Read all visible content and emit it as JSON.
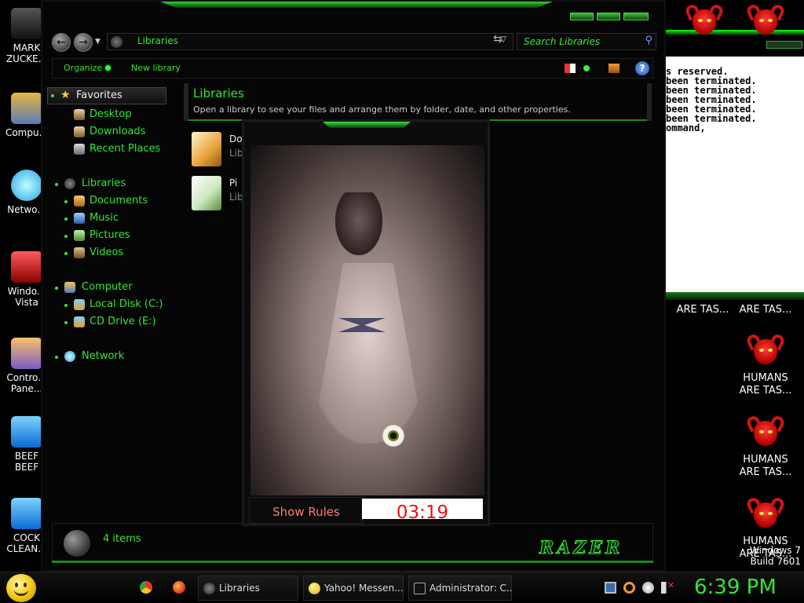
{
  "desktop": {
    "icons": [
      {
        "label": "MARK ZUCKE..."
      },
      {
        "label": "Compu..."
      },
      {
        "label": "Netwo..."
      },
      {
        "label": "Windo... Vista"
      },
      {
        "label": "Contro... Pane..."
      },
      {
        "label": "BEEF BEEF"
      },
      {
        "label": "COCK CLEAN..."
      }
    ],
    "demon_labels": [
      "ARE TAS...",
      "ARE TAS...",
      "HUMANS ARE TAS...",
      "HUMANS ARE TAS...",
      "HUMANS ARE TAS..."
    ],
    "watermark_line1": "Windows 7",
    "watermark_line2": "Build 7601"
  },
  "console": {
    "lines": [
      "s reserved.",
      "",
      "",
      "been terminated.",
      "been terminated.",
      "been terminated.",
      "been terminated.",
      "been terminated.",
      "",
      "",
      "",
      "",
      "",
      "",
      "",
      "",
      "",
      "",
      "ommand,"
    ]
  },
  "explorer": {
    "address": "Libraries",
    "search_placeholder": "Search Libraries",
    "toolbar": {
      "organize": "Organize",
      "new_library": "New library"
    },
    "nav": {
      "favorites": "Favorites",
      "desktop": "Desktop",
      "downloads": "Downloads",
      "recent": "Recent Places",
      "libraries": "Libraries",
      "documents": "Documents",
      "music": "Music",
      "pictures": "Pictures",
      "videos": "Videos",
      "computer": "Computer",
      "local_disk": "Local Disk (C:)",
      "cd_drive": "CD Drive (E:)",
      "network": "Network"
    },
    "content_title": "Libraries",
    "content_subtitle": "Open a library to see your files and arrange them by folder, date, and other properties.",
    "entries": [
      {
        "name": "Do",
        "kind": "Lib"
      },
      {
        "name": "Pi",
        "kind": "Lib"
      }
    ],
    "status_count": "4 items",
    "brand": "RAZER"
  },
  "popup": {
    "show_rules": "Show Rules",
    "timer": "03:19"
  },
  "taskbar": {
    "tasks": [
      {
        "label": "Libraries"
      },
      {
        "label": "Yahoo! Messen..."
      },
      {
        "label": "Administrator: C..."
      }
    ],
    "clock": "6:39 PM"
  },
  "colors": {
    "accent": "#33e633",
    "timer_red": "#ee1111",
    "rules_text": "#ff7a7a"
  }
}
